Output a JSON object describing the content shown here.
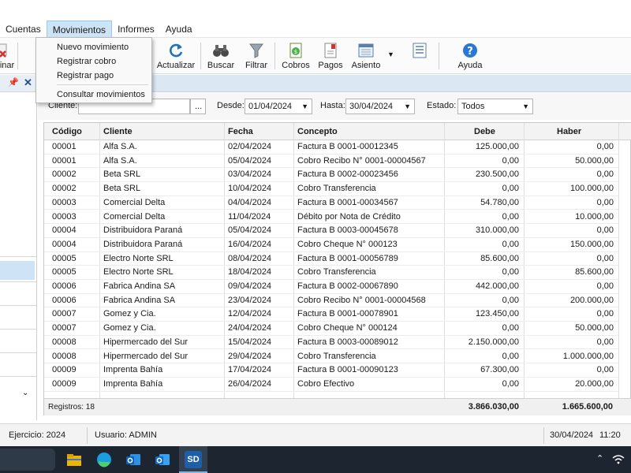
{
  "menubar": {
    "items": [
      "Cuentas",
      "Movimientos",
      "Informes",
      "Ayuda"
    ]
  },
  "movimientos_menu": {
    "items": [
      "Nuevo movimiento",
      "Registrar cobro",
      "Registrar pago",
      "Consultar movimientos"
    ]
  },
  "toolbar": {
    "partial_label": "inar",
    "actualizar": "Actualizar",
    "buscar": "Buscar",
    "filtrar": "Filtrar",
    "cobros": "Cobros",
    "pagos": "Pagos",
    "asiento": "Asiento",
    "ayuda": "Ayuda"
  },
  "filters": {
    "cliente_label": "Cliente:",
    "cliente_value": "",
    "browse_label": "...",
    "desde_label": "Desde:",
    "desde_value": "01/04/2024",
    "hasta_label": "Hasta:",
    "hasta_value": "30/04/2024",
    "estado_label": "Estado:",
    "estado_value": "Todos"
  },
  "grid": {
    "columns": [
      "Código",
      "Cliente",
      "Fecha",
      "Concepto",
      "Debe",
      "Haber"
    ],
    "rows": [
      [
        "00001",
        "Alfa S.A.",
        "02/04/2024",
        "Factura B 0001-00012345",
        "125.000,00",
        "0,00"
      ],
      [
        "00001",
        "Alfa S.A.",
        "05/04/2024",
        "Cobro Recibo N° 0001-00004567",
        "0,00",
        "50.000,00"
      ],
      [
        "00002",
        "Beta SRL",
        "03/04/2024",
        "Factura B 0002-00023456",
        "230.500,00",
        "0,00"
      ],
      [
        "00002",
        "Beta SRL",
        "10/04/2024",
        "Cobro Transferencia",
        "0,00",
        "100.000,00"
      ],
      [
        "00003",
        "Comercial Delta",
        "04/04/2024",
        "Factura B 0001-00034567",
        "54.780,00",
        "0,00"
      ],
      [
        "00003",
        "Comercial Delta",
        "11/04/2024",
        "Débito por Nota de Crédito",
        "0,00",
        "10.000,00"
      ],
      [
        "00004",
        "Distribuidora Paraná",
        "05/04/2024",
        "Factura B 0003-00045678",
        "310.000,00",
        "0,00"
      ],
      [
        "00004",
        "Distribuidora Paraná",
        "16/04/2024",
        "Cobro Cheque N° 000123",
        "0,00",
        "150.000,00"
      ],
      [
        "00005",
        "Electro Norte SRL",
        "08/04/2024",
        "Factura B 0001-00056789",
        "85.600,00",
        "0,00"
      ],
      [
        "00005",
        "Electro Norte SRL",
        "18/04/2024",
        "Cobro Transferencia",
        "0,00",
        "85.600,00"
      ],
      [
        "00006",
        "Fabrica Andina SA",
        "09/04/2024",
        "Factura B 0002-00067890",
        "442.000,00",
        "0,00"
      ],
      [
        "00006",
        "Fabrica Andina SA",
        "23/04/2024",
        "Cobro Recibo N° 0001-00004568",
        "0,00",
        "200.000,00"
      ],
      [
        "00007",
        "Gomez y Cia.",
        "12/04/2024",
        "Factura B 0001-00078901",
        "123.450,00",
        "0,00"
      ],
      [
        "00007",
        "Gomez y Cia.",
        "24/04/2024",
        "Cobro Cheque N° 000124",
        "0,00",
        "50.000,00"
      ],
      [
        "00008",
        "Hipermercado del Sur",
        "15/04/2024",
        "Factura B 0003-00089012",
        "2.150.000,00",
        "0,00"
      ],
      [
        "00008",
        "Hipermercado del Sur",
        "29/04/2024",
        "Cobro Transferencia",
        "0,00",
        "1.000.000,00"
      ],
      [
        "00009",
        "Imprenta Bahía",
        "17/04/2024",
        "Factura B 0001-00090123",
        "67.300,00",
        "0,00"
      ],
      [
        "00009",
        "Imprenta Bahía",
        "26/04/2024",
        "Cobro Efectivo",
        "0,00",
        "20.000,00"
      ]
    ],
    "footer": {
      "registros": "Registros: 18",
      "total_debe": "3.866.030,00",
      "total_haber": "1.665.600,00"
    }
  },
  "statusbar": {
    "ejercicio": "Ejercicio: 2024",
    "usuario": "Usuario: ADMIN",
    "fecha": "30/04/2024",
    "hora": "11:20"
  },
  "taskbar": {
    "active_app": "SD"
  },
  "colors": {
    "accent": "#1e73be",
    "header_band": "#dbe7f3",
    "menu_active": "#cde4f7"
  }
}
